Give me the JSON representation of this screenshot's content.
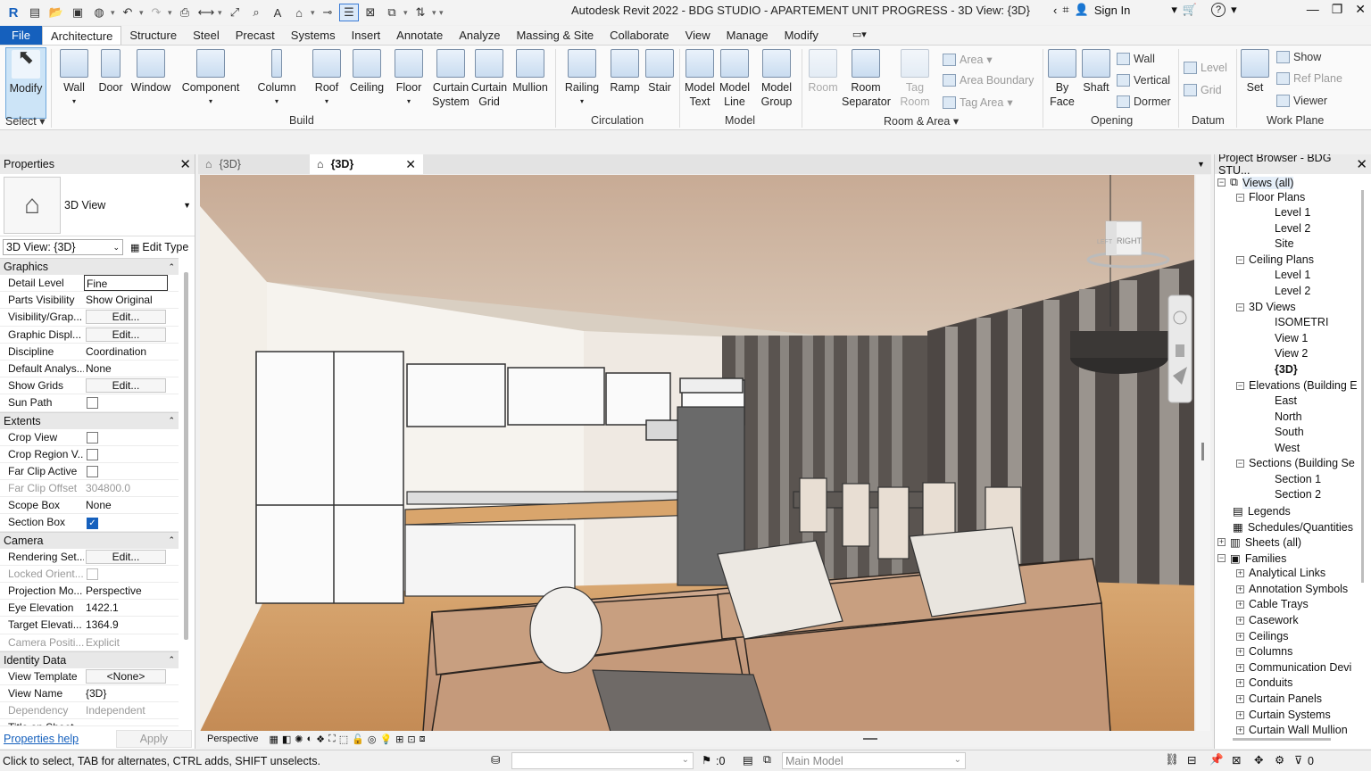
{
  "window": {
    "title": "Autodesk Revit 2022 - BDG STUDIO - APARTEMENT UNIT PROGRESS - 3D View: {3D}",
    "sign_in": "Sign In"
  },
  "menu_tabs": [
    "File",
    "Architecture",
    "Structure",
    "Steel",
    "Precast",
    "Systems",
    "Insert",
    "Annotate",
    "Analyze",
    "Massing & Site",
    "Collaborate",
    "View",
    "Manage",
    "Modify"
  ],
  "ribbon": {
    "select": {
      "modify": "Modify",
      "panel": "Select"
    },
    "build": {
      "wall": "Wall",
      "door": "Door",
      "window": "Window",
      "component": "Component",
      "column": "Column",
      "roof": "Roof",
      "ceiling": "Ceiling",
      "floor": "Floor",
      "curtain_system": "Curtain System",
      "curtain_grid": "Curtain Grid",
      "mullion": "Mullion",
      "panel": "Build"
    },
    "circulation": {
      "railing": "Railing",
      "ramp": "Ramp",
      "stair": "Stair",
      "panel": "Circulation"
    },
    "model": {
      "text": "Model Text",
      "line": "Model Line",
      "group": "Model Group",
      "panel": "Model"
    },
    "room_area": {
      "room": "Room",
      "separator": "Room Separator",
      "tag_room": "Tag Room",
      "area": "Area",
      "area_boundary": "Area Boundary",
      "tag_area": "Tag Area",
      "panel": "Room & Area"
    },
    "opening": {
      "by_face": "By Face",
      "shaft": "Shaft",
      "wall": "Wall",
      "vertical": "Vertical",
      "dormer": "Dormer",
      "panel": "Opening"
    },
    "datum": {
      "level": "Level",
      "grid": "Grid",
      "panel": "Datum"
    },
    "work_plane": {
      "set": "Set",
      "show": "Show",
      "ref_plane": "Ref Plane",
      "viewer": "Viewer",
      "panel": "Work Plane"
    }
  },
  "properties": {
    "title": "Properties",
    "type_name": "3D View",
    "instance": "3D View: {3D}",
    "edit_type": "Edit Type",
    "groups": {
      "graphics": "Graphics",
      "extents": "Extents",
      "camera": "Camera",
      "identity": "Identity Data"
    },
    "graphics": [
      [
        "Detail Level",
        "Fine"
      ],
      [
        "Parts Visibility",
        "Show Original"
      ],
      [
        "Visibility/Grap...",
        "Edit..."
      ],
      [
        "Graphic Displ...",
        "Edit..."
      ],
      [
        "Discipline",
        "Coordination"
      ],
      [
        "Default Analys...",
        "None"
      ],
      [
        "Show Grids",
        "Edit..."
      ],
      [
        "Sun Path",
        ""
      ]
    ],
    "extents": [
      [
        "Crop View",
        ""
      ],
      [
        "Crop Region V...",
        ""
      ],
      [
        "Far Clip Active",
        ""
      ],
      [
        "Far Clip Offset",
        "304800.0"
      ],
      [
        "Scope Box",
        "None"
      ],
      [
        "Section Box",
        ""
      ]
    ],
    "camera": [
      [
        "Rendering Set...",
        "Edit..."
      ],
      [
        "Locked Orient...",
        ""
      ],
      [
        "Projection Mo...",
        "Perspective"
      ],
      [
        "Eye Elevation",
        "1422.1"
      ],
      [
        "Target Elevati...",
        "1364.9"
      ],
      [
        "Camera Positi...",
        "Explicit"
      ]
    ],
    "identity": [
      [
        "View Template",
        "<None>"
      ],
      [
        "View Name",
        "{3D}"
      ],
      [
        "Dependency",
        "Independent"
      ],
      [
        "Title on Sheet",
        ""
      ]
    ],
    "help": "Properties help",
    "apply": "Apply"
  },
  "view_tabs": [
    {
      "label": "{3D}"
    },
    {
      "label": "{3D}"
    }
  ],
  "view_control": {
    "style": "Perspective",
    "viewcube_face": "RIGHT",
    "viewcube_left": "LEFT"
  },
  "browser": {
    "title": "Project Browser - BDG STU...",
    "nodes": [
      "Views (all)",
      "Floor Plans",
      "Level 1",
      "Level 2",
      "Site",
      "Ceiling Plans",
      "Level 1",
      "Level 2",
      "3D Views",
      "ISOMETRI",
      "View 1",
      "View 2",
      "{3D}",
      "Elevations (Building E",
      "East",
      "North",
      "South",
      "West",
      "Sections (Building Se",
      "Section 1",
      "Section 2",
      "Legends",
      "Schedules/Quantities",
      "Sheets (all)",
      "Families",
      "Analytical Links",
      "Annotation Symbols",
      "Cable Trays",
      "Casework",
      "Ceilings",
      "Columns",
      "Communication Devi",
      "Conduits",
      "Curtain Panels",
      "Curtain Systems",
      "Curtain Wall Mullion"
    ]
  },
  "status": {
    "hint": "Click to select, TAB for alternates, CTRL adds, SHIFT unselects.",
    "zero": ":0",
    "model": "Main Model",
    "filter": "0"
  }
}
